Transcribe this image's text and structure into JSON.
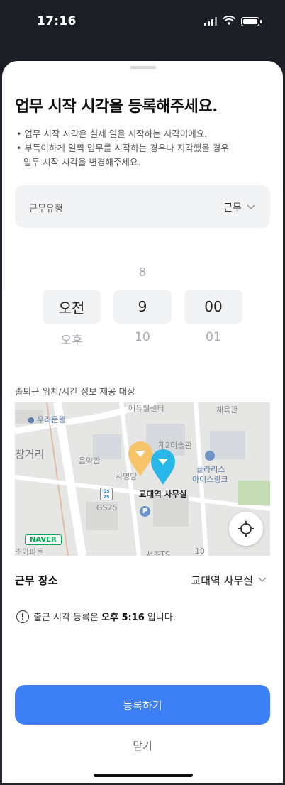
{
  "status_bar": {
    "time": "17:16"
  },
  "sheet": {
    "title": "업무 시작 시각을 등록해주세요.",
    "notes": {
      "line1": "• 업무 시작 시각은 실제 일을 시작하는 시각이에요.",
      "line2": "• 부득이하게 일찍 업무를 시작하는 경우나 지각했을 경우",
      "line3": "업무 시작 시각을 변경해주세요."
    },
    "work_type": {
      "label": "근무유형",
      "value": "근무"
    },
    "time_picker": {
      "ampm": {
        "above": "",
        "selected": "오전",
        "below": "오후"
      },
      "hour": {
        "above": "8",
        "selected": "9",
        "below": "10"
      },
      "minute": {
        "above": "",
        "selected": "00",
        "below": "01"
      }
    },
    "map_caption": "출퇴근 위치/시간 정보 제공 대상",
    "map": {
      "labels": {
        "bank": "우리은행",
        "edu": "에듀웰센터",
        "gym": "체육관",
        "street": "창거리",
        "art": "제2미술관",
        "pharmacy": "음악관",
        "plaris1": "플라리스",
        "plaris2": "아이스링크",
        "gs_left": "GS25",
        "office": "교대역 사무실",
        "apt": "초아파트",
        "seocho": "서초TS",
        "num": "10",
        "church": "사명당",
        "gs_badge": "GS 25"
      },
      "naver": "NAVER",
      "pin_colors": {
        "yellow": "#f8c46a",
        "cyan": "#27b7e8"
      }
    },
    "place": {
      "label": "근무 장소",
      "value": "교대역 사무실"
    },
    "info": {
      "prefix": "출근 시각 등록은",
      "time": "오후 5:16",
      "suffix": "입니다."
    },
    "submit_label": "등록하기",
    "close_label": "닫기",
    "accent_color": "#3d7ff4"
  }
}
